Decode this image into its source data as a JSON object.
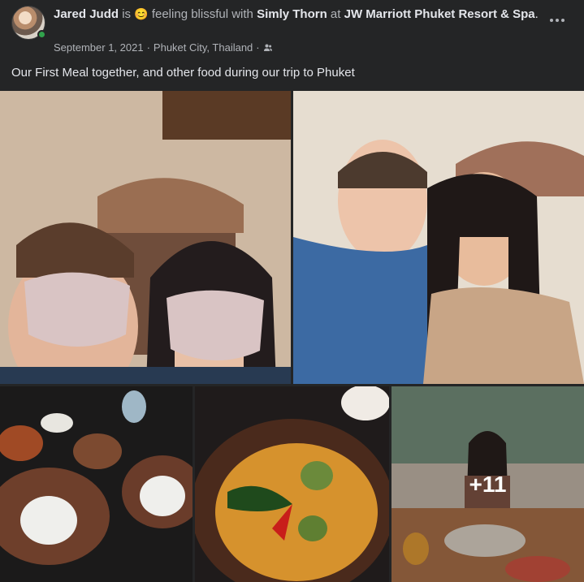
{
  "post": {
    "author": "Jared Judd",
    "verb_is": "is",
    "feeling_emoji": "😊",
    "feeling_text": "feeling blissful with",
    "tagged": "Simly Thorn",
    "at_word": "at",
    "place": "JW Marriott Phuket Resort & Spa",
    "place_end": ".",
    "date": "September 1, 2021",
    "location": "Phuket City, Thailand",
    "separator": "·",
    "audience_icon": "friends-icon",
    "more_icon": "more-options-icon",
    "caption": "Our First Meal together, and other food during our trip to Phuket"
  },
  "photos": {
    "more_count": "+11"
  },
  "colors": {
    "background": "#242526",
    "primary_text": "#e4e6eb",
    "secondary_text": "#b0b3b8",
    "online": "#31a24c"
  }
}
